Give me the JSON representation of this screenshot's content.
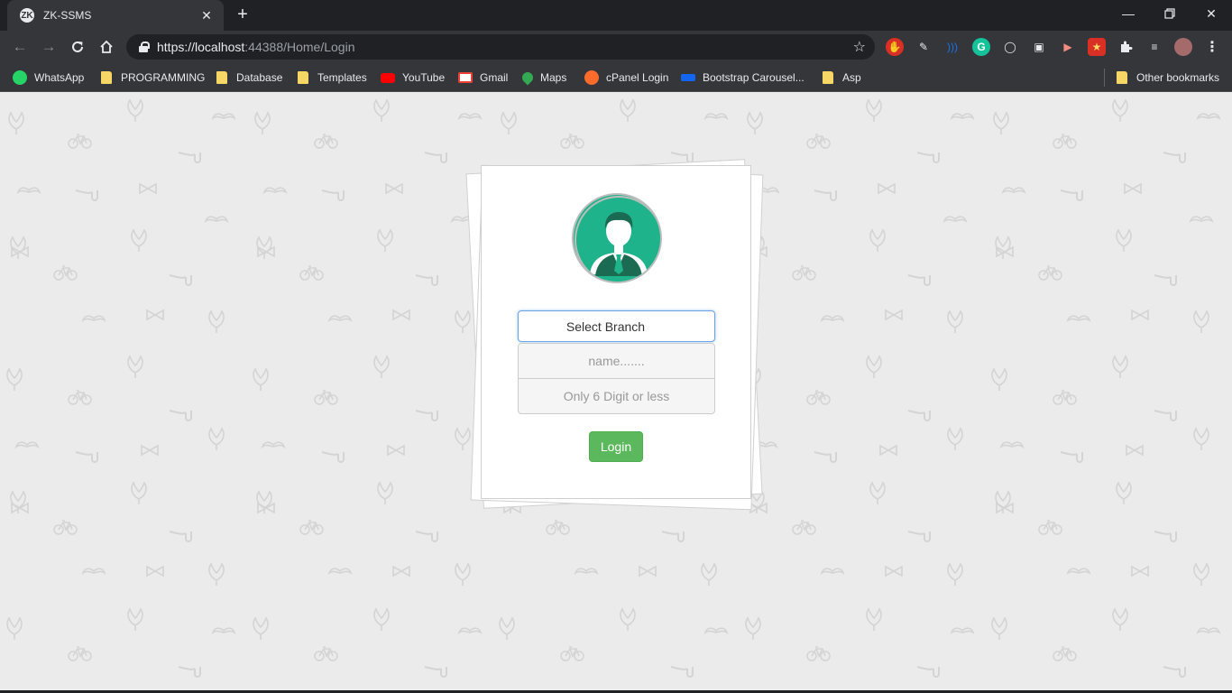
{
  "browser": {
    "tab_title": "ZK-SSMS",
    "tab_favicon": "ZK",
    "url_host": "https://localhost",
    "url_rest": ":44388/Home/Login"
  },
  "bookmarks": [
    {
      "label": "WhatsApp",
      "icon": "whatsapp-icon",
      "color": "#25d366"
    },
    {
      "label": "PROGRAMMING",
      "icon": "folder-icon",
      "color": "#f6d665"
    },
    {
      "label": "Database",
      "icon": "folder-icon",
      "color": "#f6d665"
    },
    {
      "label": "Templates",
      "icon": "folder-icon",
      "color": "#f6d665"
    },
    {
      "label": "YouTube",
      "icon": "youtube-icon",
      "color": "#ff0000"
    },
    {
      "label": "Gmail",
      "icon": "gmail-icon",
      "color": "#ea4335"
    },
    {
      "label": "Maps",
      "icon": "maps-icon",
      "color": "#34a853"
    },
    {
      "label": "cPanel Login",
      "icon": "cpanel-icon",
      "color": "#ff6c2c"
    },
    {
      "label": "Bootstrap Carousel...",
      "icon": "mdb-icon",
      "color": "#1266f1"
    },
    {
      "label": "Asp",
      "icon": "folder-icon",
      "color": "#f6d665"
    }
  ],
  "other_bookmarks": "Other bookmarks",
  "login": {
    "branch_select": "Select Branch",
    "name_placeholder": "name.......",
    "code_placeholder": "Only 6 Digit or less",
    "login_button": "Login"
  },
  "colors": {
    "accent_green": "#5cb85c",
    "avatar_teal": "#1fb38b",
    "chrome_dark": "#35363a"
  }
}
